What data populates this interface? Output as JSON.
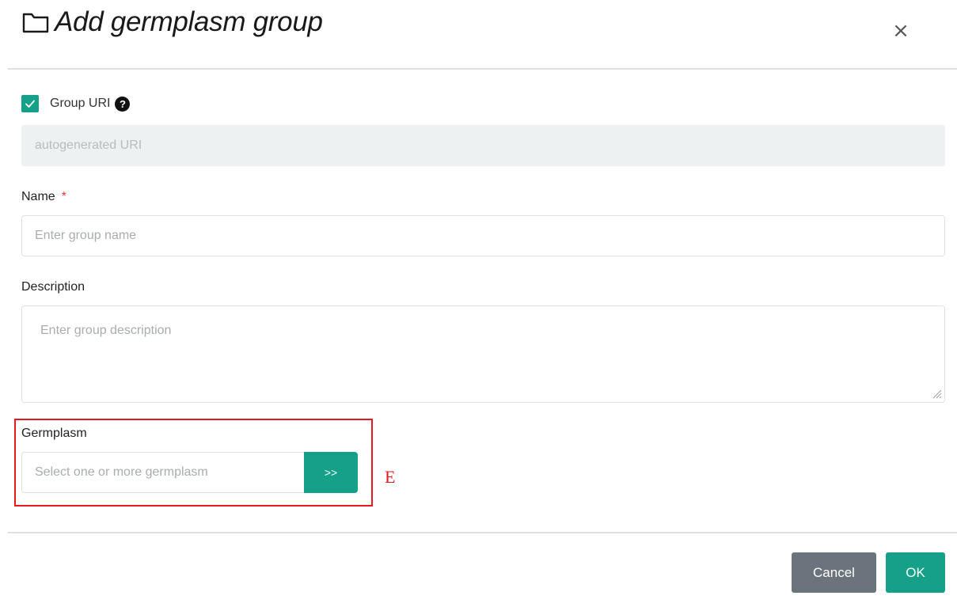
{
  "dialog": {
    "title": "Add germplasm group",
    "close_label": "×"
  },
  "uri": {
    "checkbox_checked": true,
    "label": "Group URI",
    "help_icon": "?",
    "placeholder": "autogenerated URI"
  },
  "name": {
    "label": "Name",
    "required_marker": "*",
    "placeholder": "Enter group name"
  },
  "description": {
    "label": "Description",
    "placeholder": "Enter group description"
  },
  "germplasm": {
    "label": "Germplasm",
    "placeholder": "Select one or more germplasm",
    "button_label": ">>"
  },
  "annotation": {
    "letter": "E",
    "color": "#e41a1c"
  },
  "footer": {
    "cancel_label": "Cancel",
    "ok_label": "OK"
  },
  "colors": {
    "accent": "#14a089",
    "cancel": "#6b747c",
    "required": "#e53935"
  },
  "icons": {
    "title": "folder-icon",
    "close": "close-icon",
    "help": "help-icon",
    "check": "check-icon",
    "resize": "resize-grip-icon"
  }
}
